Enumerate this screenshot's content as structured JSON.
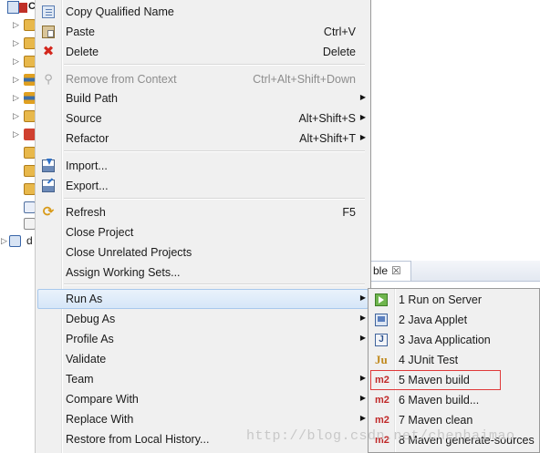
{
  "project_tree": {
    "root_label": "C",
    "collapsed_project_label": "d"
  },
  "view_tab": {
    "label": "ble",
    "close_glyph": "☒"
  },
  "context_menu": {
    "items": [
      {
        "label": "Copy Qualified Name",
        "shortcut": "",
        "icon": "copy-qualified-name-icon"
      },
      {
        "label": "Paste",
        "shortcut": "Ctrl+V",
        "icon": "paste-icon"
      },
      {
        "label": "Delete",
        "shortcut": "Delete",
        "icon": "delete-icon"
      },
      {
        "label": "Remove from Context",
        "shortcut": "Ctrl+Alt+Shift+Down",
        "icon": "remove-context-icon",
        "disabled": true
      },
      {
        "label": "Build Path",
        "shortcut": "",
        "submenu": true
      },
      {
        "label": "Source",
        "shortcut": "Alt+Shift+S",
        "submenu": true
      },
      {
        "label": "Refactor",
        "shortcut": "Alt+Shift+T",
        "submenu": true
      },
      {
        "label": "Import...",
        "shortcut": "",
        "icon": "import-icon"
      },
      {
        "label": "Export...",
        "shortcut": "",
        "icon": "export-icon"
      },
      {
        "label": "Refresh",
        "shortcut": "F5",
        "icon": "refresh-icon"
      },
      {
        "label": "Close Project",
        "shortcut": ""
      },
      {
        "label": "Close Unrelated Projects",
        "shortcut": ""
      },
      {
        "label": "Assign Working Sets...",
        "shortcut": ""
      },
      {
        "label": "Run As",
        "shortcut": "",
        "submenu": true,
        "highlighted": true
      },
      {
        "label": "Debug As",
        "shortcut": "",
        "submenu": true
      },
      {
        "label": "Profile As",
        "shortcut": "",
        "submenu": true
      },
      {
        "label": "Validate",
        "shortcut": ""
      },
      {
        "label": "Team",
        "shortcut": "",
        "submenu": true
      },
      {
        "label": "Compare With",
        "shortcut": "",
        "submenu": true
      },
      {
        "label": "Replace With",
        "shortcut": "",
        "submenu": true
      },
      {
        "label": "Restore from Local History...",
        "shortcut": ""
      }
    ]
  },
  "run_as_submenu": {
    "items": [
      {
        "label": "1 Run on Server",
        "icon": "run-on-server-icon"
      },
      {
        "label": "2 Java Applet",
        "icon": "java-applet-icon"
      },
      {
        "label": "3 Java Application",
        "icon": "java-application-icon",
        "icon_text": "J"
      },
      {
        "label": "4 JUnit Test",
        "icon": "junit-icon",
        "icon_text": "Ju"
      },
      {
        "label": "5 Maven build",
        "icon": "maven-icon",
        "icon_text": "m2",
        "highlighted": true
      },
      {
        "label": "6 Maven build...",
        "icon": "maven-icon",
        "icon_text": "m2"
      },
      {
        "label": "7 Maven clean",
        "icon": "maven-icon",
        "icon_text": "m2"
      },
      {
        "label": "8 Maven generate-sources",
        "icon": "maven-icon",
        "icon_text": "m2"
      }
    ]
  },
  "watermark": "http://blog.csdn.net/chenhaimao",
  "colors": {
    "menu_background": "#f0f0f0",
    "highlight_border": "#e03a3a",
    "maven_icon": "#c02828"
  }
}
